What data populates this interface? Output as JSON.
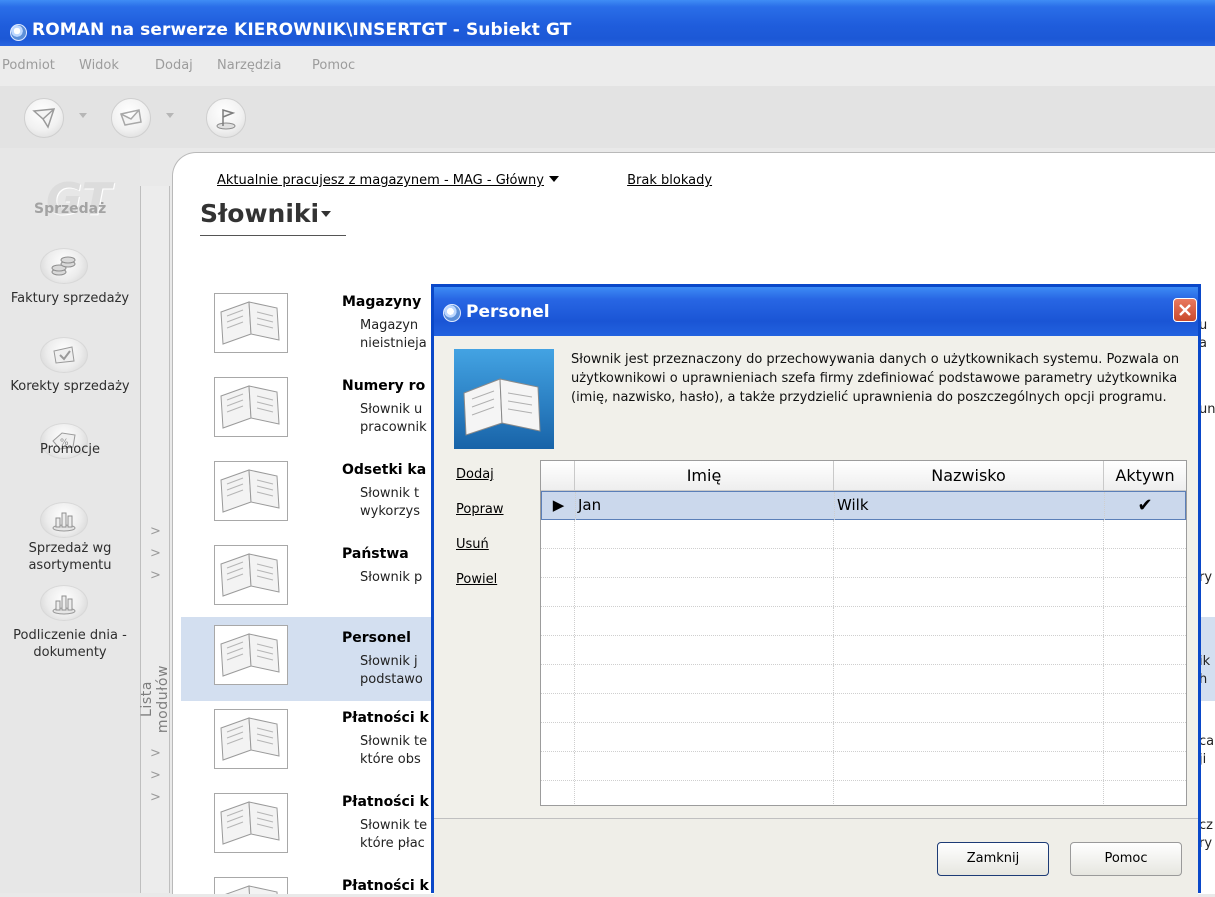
{
  "window": {
    "title": "ROMAN na serwerze KIEROWNIK\\INSERTGT - Subiekt GT"
  },
  "menu": [
    "Podmiot",
    "Widok",
    "Dodaj",
    "Narzędzia",
    "Pomoc"
  ],
  "toolbar": {
    "icons": [
      "send-icon",
      "receive-icon",
      "flag-icon"
    ]
  },
  "sidebar": {
    "logo": "GT",
    "module": "Sprzedaż",
    "items": [
      {
        "label": "Faktury sprzedaży",
        "icon": "coins-icon"
      },
      {
        "label": "Korekty sprzedaży",
        "icon": "correction-icon"
      },
      {
        "label": "Promocje",
        "icon": "discount-tag-icon"
      },
      {
        "label": "Sprzedaż wg asortymentu",
        "icon": "bar-chart-icon"
      },
      {
        "label": "Podliczenie dnia - dokumenty",
        "icon": "bar-chart-icon"
      }
    ],
    "strip_label": "Lista modułów"
  },
  "content": {
    "status_magazyn": "Aktualnie pracujesz z magazynem - MAG - Główny",
    "status_lock": "Brak blokady",
    "page_title": "Słowniki"
  },
  "dictionaries": [
    {
      "name": "Magazyny",
      "line1": "Magazyn",
      "line2": "nieistnieja",
      "right1": "u",
      "right2": "a"
    },
    {
      "name": "Numery ro",
      "line1": "Słownik u",
      "line2": "pracownik",
      "right1": "",
      "right2": "un"
    },
    {
      "name": "Odsetki ka",
      "line1": "Słownik t",
      "line2": "wykorzys",
      "right1": "",
      "right2": ""
    },
    {
      "name": "Państwa",
      "line1": "Słownik p",
      "line2": "",
      "right1": "ry",
      "right2": ""
    },
    {
      "name": "Personel",
      "line1": "Słownik j",
      "line2": "podstawo",
      "right1": "ik",
      "right2": "h"
    },
    {
      "name": "Płatności k",
      "line1": "Słownik te",
      "line2": "które obs",
      "right1": "ca",
      "right2": "ji"
    },
    {
      "name": "Płatności k",
      "line1": "Słownik te",
      "line2": "które płac",
      "right1": "cz",
      "right2": "ry"
    },
    {
      "name": "Płatności k",
      "line1": "",
      "line2": "",
      "right1": "",
      "right2": ""
    }
  ],
  "dialog": {
    "title": "Personel",
    "info": "Słownik jest przeznaczony do przechowywania danych o użytkownikach systemu. Pozwala on użytkownikowi o uprawnieniach szefa firmy zdefiniować podstawowe parametry użytkownika (imię, nazwisko, hasło), a także przydzielić uprawnienia do poszczególnych opcji programu.",
    "actions": [
      "Dodaj",
      "Popraw",
      "Usuń",
      "Powiel"
    ],
    "grid": {
      "columns": [
        "Imię",
        "Nazwisko",
        "Aktywn"
      ],
      "rows": [
        {
          "imie": "Jan",
          "nazwisko": "Wilk",
          "aktywny": "✔"
        }
      ]
    },
    "buttons": {
      "close": "Zamknij",
      "help": "Pomoc"
    }
  }
}
